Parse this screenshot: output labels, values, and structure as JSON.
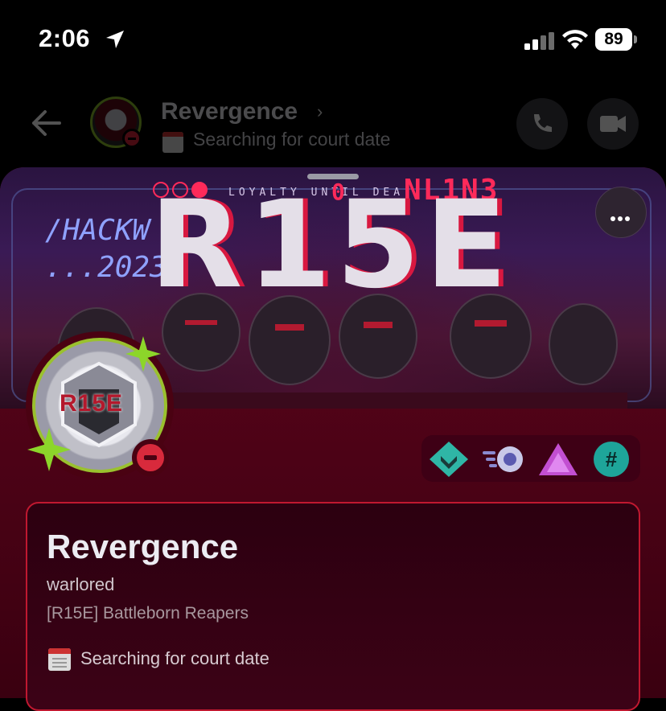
{
  "status_bar": {
    "time": "2:06",
    "battery": "89"
  },
  "chat_header": {
    "name": "Revergence",
    "status": "Searching for court date"
  },
  "banner": {
    "small_text": "LOYALTY UNTIL DEA",
    "online_text": "NL1N3",
    "zero": "0",
    "hack_text": "/HACKW",
    "year_text": "...2023",
    "logo_text": "R15E"
  },
  "avatar": {
    "logo_text": "R15E",
    "ring_color": "#9ac12e",
    "status": "do-not-disturb"
  },
  "badges": [
    {
      "name": "hypesquad-icon",
      "color": "#2fb6a6"
    },
    {
      "name": "nitro-icon",
      "color": "#c8c8e8"
    },
    {
      "name": "triangle-icon",
      "color": "#c24fd1"
    },
    {
      "name": "hashtag-icon",
      "color": "#1ea59a"
    }
  ],
  "profile": {
    "display_name": "Revergence",
    "username": "warlored",
    "pronouns": "[R15E] Battleborn Reapers",
    "custom_status": "Searching for court date"
  },
  "colors": {
    "accent": "#c01830",
    "background": "#520318"
  }
}
